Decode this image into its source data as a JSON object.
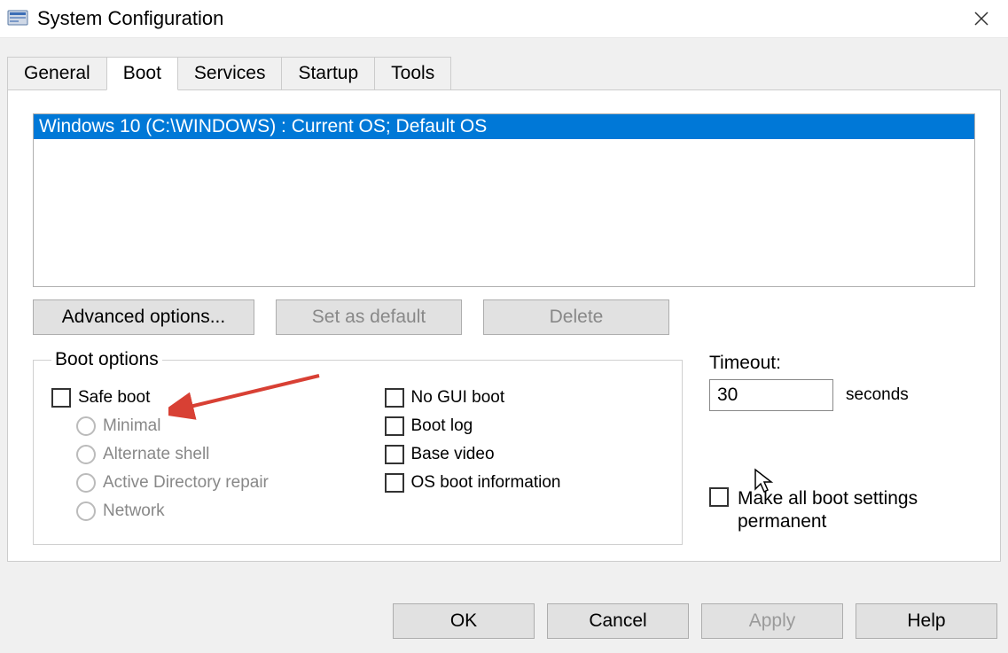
{
  "window": {
    "title": "System Configuration"
  },
  "tabs": {
    "general": "General",
    "boot": "Boot",
    "services": "Services",
    "startup": "Startup",
    "tools": "Tools"
  },
  "osList": {
    "items": [
      "Windows 10 (C:\\WINDOWS) : Current OS; Default OS"
    ]
  },
  "buttons": {
    "advanced": "Advanced options...",
    "setDefault": "Set as default",
    "delete": "Delete"
  },
  "bootOptions": {
    "legend": "Boot options",
    "safeBoot": "Safe boot",
    "minimal": "Minimal",
    "alternateShell": "Alternate shell",
    "adRepair": "Active Directory repair",
    "network": "Network",
    "noGuiBoot": "No GUI boot",
    "bootLog": "Boot log",
    "baseVideo": "Base video",
    "osBootInfo": "OS boot information"
  },
  "timeout": {
    "label": "Timeout:",
    "value": "30",
    "unit": "seconds"
  },
  "permanent": {
    "label": "Make all boot settings permanent"
  },
  "bottom": {
    "ok": "OK",
    "cancel": "Cancel",
    "apply": "Apply",
    "help": "Help"
  }
}
